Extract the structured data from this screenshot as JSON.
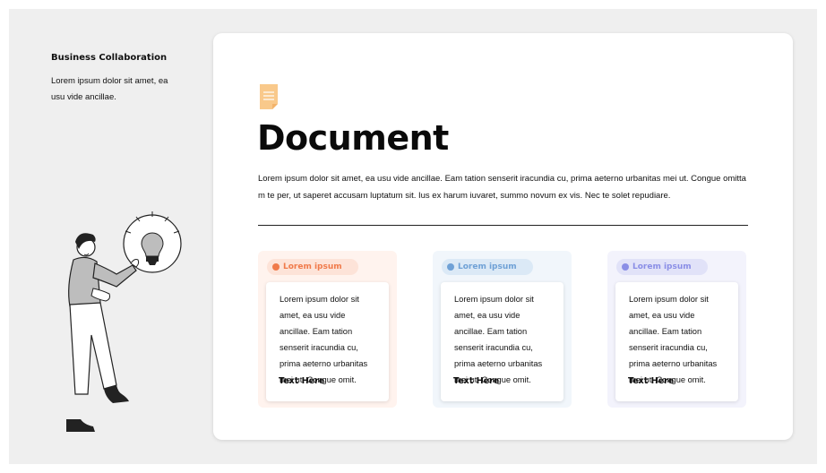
{
  "sidebar": {
    "title": "Business Collaboration",
    "text": "Lorem ipsum dolor sit amet, ea usu vide ancillae."
  },
  "main": {
    "heading": "Document",
    "paragraph": "Lorem ipsum dolor sit amet, ea usu vide ancillae. Eam tation senserit iracundia cu, prima aeterno urbanitas mei ut. Congue omittam te per, ut saperet accusam luptatum sit. Ius ex harum iuvaret, summo novum ex vis. Nec te solet repudiare.",
    "icon": "document-icon"
  },
  "cards": [
    {
      "label": "Lorem ipsum",
      "body": "Lorem ipsum dolor sit amet, ea usu vide ancillae. Eam tation senserit iracundia cu, prima aeterno urbanitas mei ut. Congue omit.",
      "footer": "Text Here",
      "accent": "#f07a4a",
      "pill_bg": "#fde3d8",
      "box_bg": "#fff3ee"
    },
    {
      "label": "Lorem ipsum",
      "body": "Lorem ipsum dolor sit amet, ea usu vide ancillae. Eam tation senserit iracundia cu, prima aeterno urbanitas mei ut. Congue omit.",
      "footer": "Text Here",
      "accent": "#6fa1d6",
      "pill_bg": "#dbe9f6",
      "box_bg": "#f1f6fb"
    },
    {
      "label": "Lorem ipsum",
      "body": "Lorem ipsum dolor sit amet, ea usu vide ancillae. Eam tation senserit iracundia cu, prima aeterno urbanitas mei ut. Congue omit.",
      "footer": "Text Here",
      "accent": "#8a8ee6",
      "pill_bg": "#e1e2f8",
      "box_bg": "#f3f3fc"
    }
  ],
  "illustration": "person-holding-lightbulb-illustration"
}
